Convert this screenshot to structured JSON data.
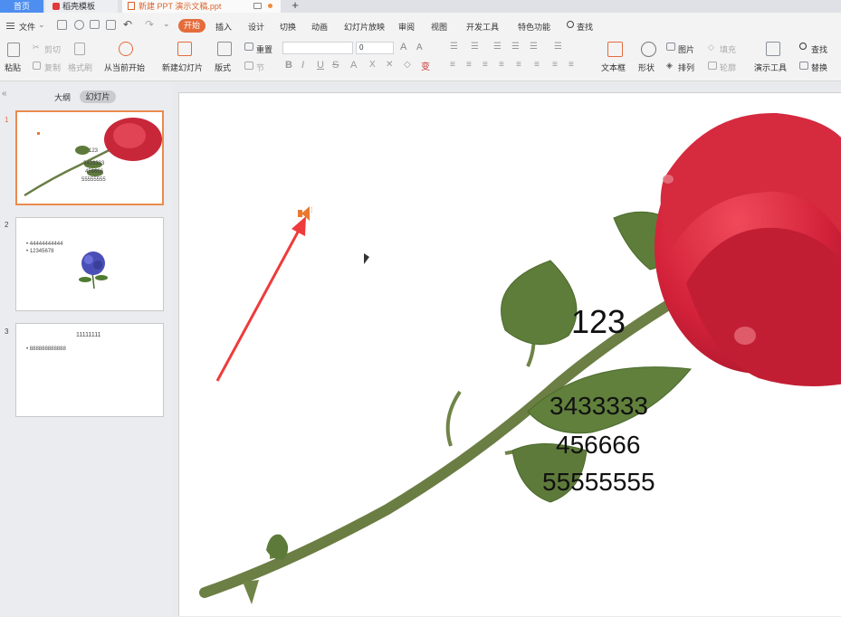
{
  "tabs": {
    "home": "首页",
    "template": "稻壳模板",
    "document": "新建 PPT 演示文稿.ppt",
    "new_tab": "+"
  },
  "menu": {
    "file": "文件",
    "items": [
      "开始",
      "插入",
      "设计",
      "切换",
      "动画",
      "幻灯片放映",
      "审阅",
      "视图",
      "开发工具",
      "特色功能"
    ],
    "search": "查找"
  },
  "ribbon": {
    "paste": "粘贴",
    "cut": "剪切",
    "copy": "复制",
    "format_painter": "格式刷",
    "from_current": "从当前开始",
    "new_slide": "新建幻灯片",
    "layout": "版式",
    "reset": "重置",
    "section": "节",
    "font_size": "0",
    "text_box": "文本框",
    "shape": "形状",
    "picture": "图片",
    "fill": "填充",
    "arrange": "排列",
    "outline": "轮廓",
    "presentation_tools": "演示工具",
    "find": "查找",
    "replace": "替换"
  },
  "panel": {
    "outline_tab": "大纲",
    "slides_tab": "幻灯片"
  },
  "thumbnails": [
    {
      "number": "1",
      "texts": [
        "123",
        "3433333",
        "456666",
        "55555555"
      ]
    },
    {
      "number": "2",
      "texts": [
        "• 44444444444",
        "• 12345678"
      ]
    },
    {
      "number": "3",
      "title": "11111111",
      "texts": [
        "• 888888888888"
      ]
    }
  ],
  "slide": {
    "texts": [
      "123",
      "3433333",
      "456666",
      "55555555"
    ]
  },
  "colors": {
    "accent": "#e46c3b",
    "home_tab": "#4e8ef0",
    "arrow": "#ee3b3b",
    "selected_border": "#e98b4f"
  }
}
